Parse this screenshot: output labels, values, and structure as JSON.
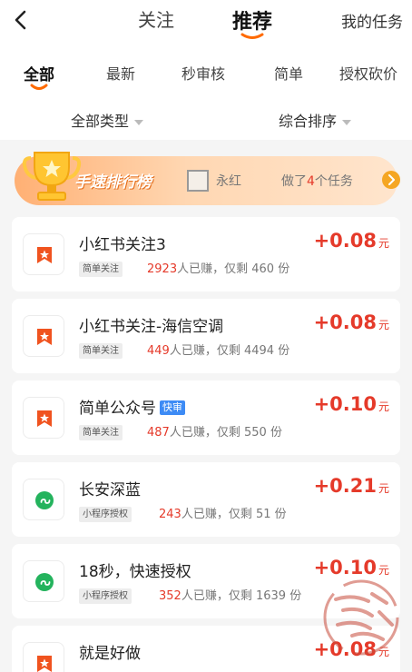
{
  "header": {
    "tabs": [
      {
        "label": "关注"
      },
      {
        "label": "推荐"
      }
    ],
    "my_tasks": "我的任务"
  },
  "subtabs": [
    "全部",
    "最新",
    "秒审核",
    "简单",
    "授权砍价"
  ],
  "filters": {
    "type": "全部类型",
    "sort": "综合排序"
  },
  "rank_banner": {
    "title": "手速排行榜",
    "name": "永红",
    "desc_prefix": "做了",
    "count": "4",
    "desc_suffix": "个任务"
  },
  "colors": {
    "accent": "#e53a2a",
    "orange": "#f5a623",
    "fast_tag": "#3d8bf5"
  },
  "tasks": [
    {
      "title": "小红书关注3",
      "tag": "",
      "type": "简单关注",
      "earned": "2923",
      "earned_suffix": "人已赚，仅剩",
      "remaining": "460",
      "unit_remain": "份",
      "price": "+0.08",
      "currency": "元",
      "icon": "bookmark-star-icon"
    },
    {
      "title": "小红书关注-海信空调",
      "tag": "",
      "type": "简单关注",
      "earned": "449",
      "earned_suffix": "人已赚，仅剩",
      "remaining": "4494",
      "unit_remain": "份",
      "price": "+0.08",
      "currency": "元",
      "icon": "bookmark-star-icon"
    },
    {
      "title": "简单公众号",
      "tag": "快审",
      "type": "简单关注",
      "earned": "487",
      "earned_suffix": "人已赚，仅剩",
      "remaining": "550",
      "unit_remain": "份",
      "price": "+0.10",
      "currency": "元",
      "icon": "bookmark-star-icon"
    },
    {
      "title": "长安深蓝",
      "tag": "",
      "type": "小程序授权",
      "earned": "243",
      "earned_suffix": "人已赚，仅剩",
      "remaining": "51",
      "unit_remain": "份",
      "price": "+0.21",
      "currency": "元",
      "icon": "mini-program-icon"
    },
    {
      "title": "18秒，快速授权",
      "tag": "",
      "type": "小程序授权",
      "earned": "352",
      "earned_suffix": "人已赚，仅剩",
      "remaining": "1639",
      "unit_remain": "份",
      "price": "+0.10",
      "currency": "元",
      "icon": "mini-program-icon"
    },
    {
      "title": "就是好做",
      "tag": "",
      "type": "",
      "earned": "",
      "earned_suffix": "",
      "remaining": "",
      "unit_remain": "",
      "price": "+0.08",
      "currency": "元",
      "icon": "bookmark-star-icon"
    }
  ]
}
